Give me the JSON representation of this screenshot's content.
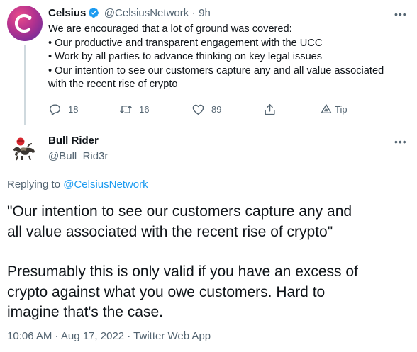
{
  "parent_tweet": {
    "name": "Celsius",
    "handle": "@CelsiusNetwork",
    "separator": "·",
    "time": "9h",
    "lines": [
      "We are encouraged that a lot of ground was covered:",
      "• Our productive and transparent engagement with the UCC",
      "• Work by all parties to advance thinking on key legal issues",
      "• Our intention to see our customers capture any and all value associated",
      "with the recent rise of crypto"
    ],
    "more": "•••",
    "actions": {
      "replies": "18",
      "retweets": "16",
      "likes": "89",
      "tip": "Tip"
    }
  },
  "reply_tweet": {
    "name": "Bull Rider",
    "handle": "@Bull_Rid3r",
    "more": "•••",
    "replying_prefix": "Replying to",
    "replying_to": "@CelsiusNetwork",
    "paragraph_1_line_1": "\"Our intention to see our customers capture any and",
    "paragraph_1_line_2": "all value associated with the recent rise of crypto\"",
    "paragraph_2_line_1": "Presumably this is only valid if you have an excess of",
    "paragraph_2_line_2": "crypto against what you owe customers. Hard to",
    "paragraph_2_line_3": "imagine that's the case.",
    "meta": "10:06 AM · Aug 17, 2022 · Twitter Web App"
  },
  "colors": {
    "text": "#0f1419",
    "muted": "#536471",
    "link": "#1d9bf0",
    "verified": "#1d9bf0"
  }
}
